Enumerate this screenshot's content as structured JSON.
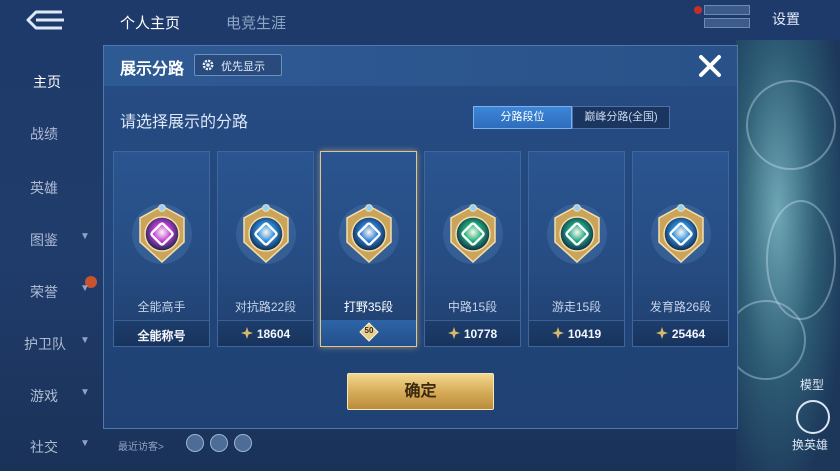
{
  "top_tabs": [
    {
      "label": "个人主页",
      "active": true
    },
    {
      "label": "电竞生涯",
      "active": false
    }
  ],
  "top_right": {
    "settings_label": "设置"
  },
  "left_nav": [
    {
      "label": "主页",
      "active": true,
      "has_chevron": false
    },
    {
      "label": "战绩",
      "active": false,
      "has_chevron": false
    },
    {
      "label": "英雄",
      "active": false,
      "has_chevron": false
    },
    {
      "label": "图鉴",
      "active": false,
      "has_chevron": true
    },
    {
      "label": "荣誉",
      "active": false,
      "has_chevron": true
    },
    {
      "label": "护卫队",
      "active": false,
      "has_chevron": true
    },
    {
      "label": "游戏",
      "active": false,
      "has_chevron": true
    },
    {
      "label": "社交",
      "active": false,
      "has_chevron": true
    }
  ],
  "right_panel": {
    "model_label": "模型",
    "swap_label": "换英雄"
  },
  "bottom": {
    "visitors_label": "最近访客>"
  },
  "dialog": {
    "title": "展示分路",
    "priority_button_label": "优先显示",
    "prompt": "请选择展示的分路",
    "segments": [
      {
        "label": "分路段位",
        "active": true
      },
      {
        "label": "巅峰分路(全国)",
        "active": false
      }
    ],
    "cards": [
      {
        "label": "全能高手",
        "footer": "全能称号",
        "icon": "all-round-emblem",
        "color": "#c23fd6",
        "selected": false
      },
      {
        "label": "对抗路22段",
        "footer": "18604",
        "icon": "clash-lane-emblem",
        "color": "#2f8fe0",
        "selected": false
      },
      {
        "label": "打野35段",
        "footer": "50",
        "icon": "jungle-emblem",
        "color": "#2f7fd8",
        "selected": true
      },
      {
        "label": "中路15段",
        "footer": "10778",
        "icon": "mid-lane-emblem",
        "color": "#21b27a",
        "selected": false
      },
      {
        "label": "游走15段",
        "footer": "10419",
        "icon": "roam-emblem",
        "color": "#22a884",
        "selected": false
      },
      {
        "label": "发育路26段",
        "footer": "25464",
        "icon": "farm-lane-emblem",
        "color": "#2f8fe0",
        "selected": false
      }
    ],
    "confirm_label": "确定"
  },
  "colors": {
    "accent_gold": "#d4a955",
    "panel_blue": "#274d85",
    "selected_border": "#e3c58a"
  }
}
